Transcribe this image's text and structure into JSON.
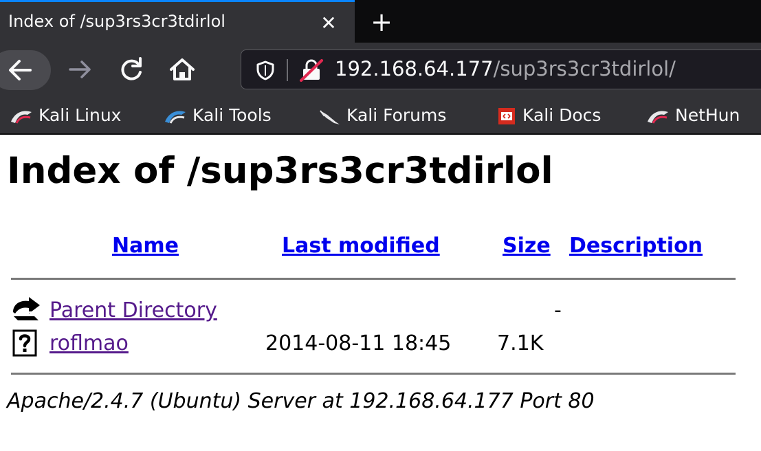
{
  "browser": {
    "tab": {
      "title": "Index of /sup3rs3cr3tdirlol",
      "close": "✕"
    },
    "new_tab": "+",
    "url": {
      "host": "192.168.64.177",
      "path": "/sup3rs3cr3tdirlol/"
    },
    "bookmarks": [
      {
        "label": "Kali Linux",
        "icon": "kali-dragon-icon"
      },
      {
        "label": "Kali Tools",
        "icon": "kali-tools-icon"
      },
      {
        "label": "Kali Forums",
        "icon": "kali-forums-icon"
      },
      {
        "label": "Kali Docs",
        "icon": "kali-docs-icon"
      },
      {
        "label": "NetHun",
        "icon": "nethunter-icon"
      }
    ]
  },
  "page": {
    "heading": "Index of /sup3rs3cr3tdirlol",
    "columns": {
      "name": "Name",
      "last_modified": "Last modified",
      "size": "Size",
      "description": "Description"
    },
    "rows": [
      {
        "name": "Parent Directory",
        "modified": "",
        "size": "-",
        "icon": "parent-directory-icon"
      },
      {
        "name": "roflmao",
        "modified": "2014-08-11 18:45",
        "size": "7.1K",
        "icon": "unknown-file-icon"
      }
    ],
    "footer": "Apache/2.4.7 (Ubuntu) Server at 192.168.64.177 Port 80"
  },
  "colors": {
    "chrome": "#323236",
    "tabbar": "#0c0c0d",
    "accent": "#0a84ff",
    "link": "#0000ee",
    "visited": "#551a8b"
  }
}
